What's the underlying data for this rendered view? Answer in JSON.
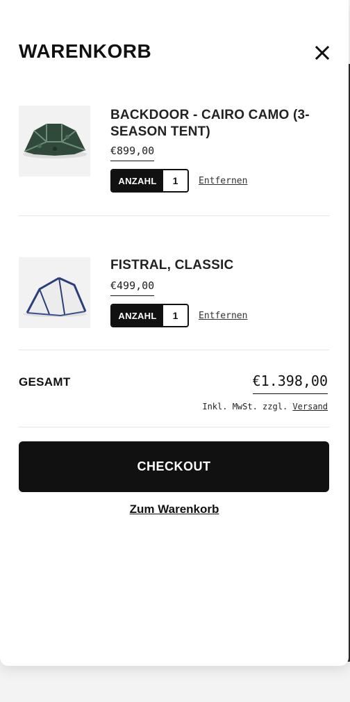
{
  "drawer": {
    "title": "WARENKORB",
    "close_icon": "close-icon"
  },
  "items": [
    {
      "name": "BACKDOOR - CAIRO CAMO (3-SEASON TENT)",
      "price": "€899,00",
      "qty_label": "ANZAHL",
      "qty": "1",
      "remove_label": "Entfernen",
      "image": "dark-green-camo-tent"
    },
    {
      "name": "FISTRAL, CLASSIC",
      "price": "€499,00",
      "qty_label": "ANZAHL",
      "qty": "1",
      "remove_label": "Entfernen",
      "image": "white-blue-tent"
    }
  ],
  "summary": {
    "total_label": "GESAMT",
    "total_value": "€1.398,00",
    "tax_note": "Inkl. MwSt. zzgl.",
    "shipping_link": "Versand"
  },
  "actions": {
    "checkout_label": "CHECKOUT",
    "cart_link_label": "Zum Warenkorb"
  },
  "colors": {
    "primary": "#111111",
    "background": "#ffffff",
    "divider": "#e6e6e6"
  }
}
